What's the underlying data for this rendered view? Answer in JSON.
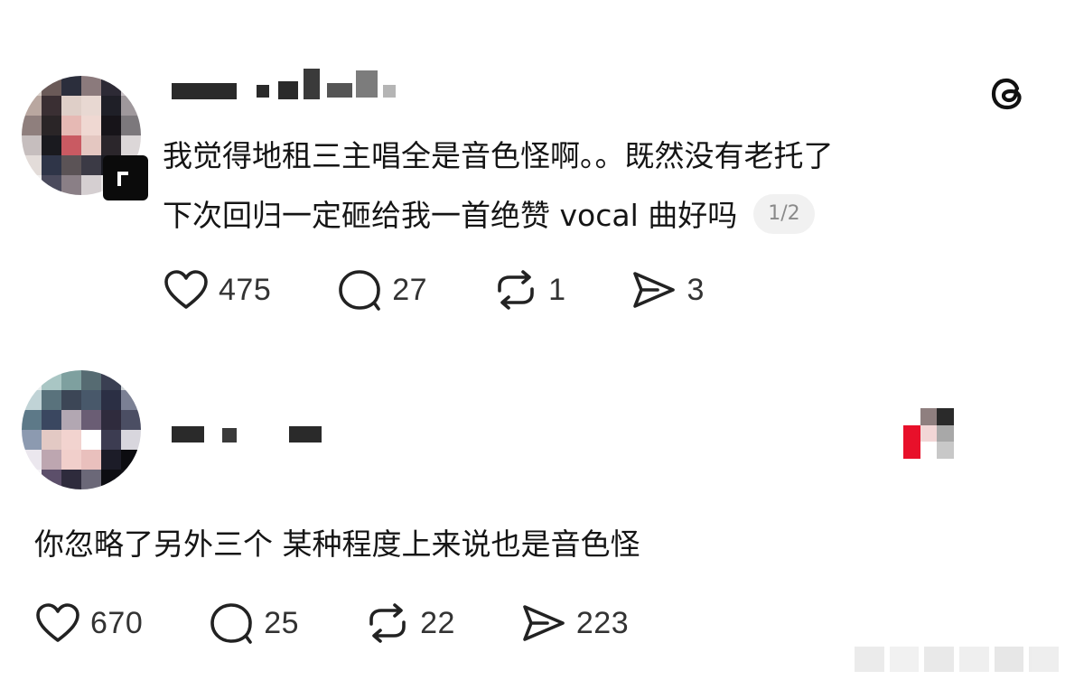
{
  "post": {
    "line1": "我觉得地租三主唱全是音色怪啊。。既然没有老托了",
    "line2": "下次回归一定砸给我一首绝赞 vocal 曲好吗",
    "page_indicator": "1/2",
    "likes": "475",
    "replies": "27",
    "reposts": "1",
    "shares": "3"
  },
  "reply": {
    "text": "你忽略了另外三个 某种程度上来说也是音色怪",
    "likes": "670",
    "replies": "25",
    "reposts": "22",
    "shares": "223"
  },
  "icons": {
    "app": "threads-icon",
    "like": "heart-icon",
    "reply": "comment-bubble-icon",
    "repost": "repost-icon",
    "share": "send-icon"
  }
}
